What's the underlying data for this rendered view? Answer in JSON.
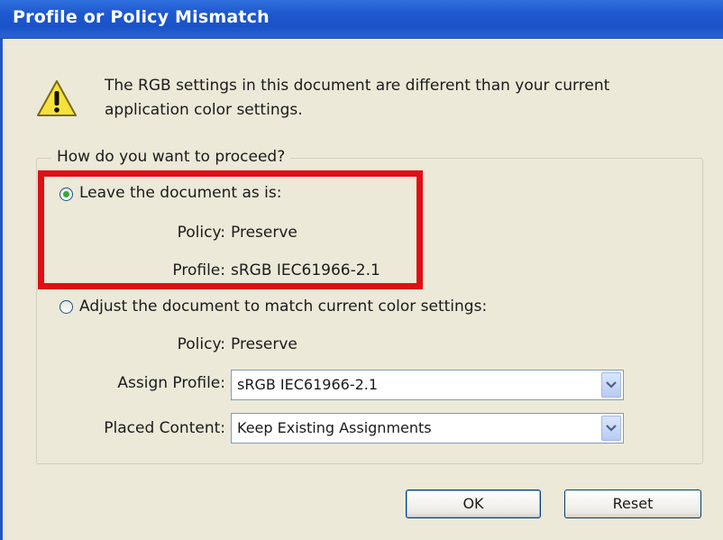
{
  "window": {
    "title": "Profile or Policy Mismatch"
  },
  "message": {
    "line1": "The RGB settings in this document are different than your current",
    "line2": "application color settings."
  },
  "group": {
    "legend": "How do you want to proceed?",
    "option_leave": {
      "label": "Leave the document as is:",
      "selected": true,
      "policy_label": "Policy:",
      "policy_value": "Preserve",
      "profile_label": "Profile:",
      "profile_value": "sRGB IEC61966-2.1"
    },
    "option_adjust": {
      "label": "Adjust the document to match current color settings:",
      "selected": false,
      "policy_label": "Policy:",
      "policy_value": "Preserve",
      "assign_profile_label": "Assign Profile:",
      "assign_profile_value": "sRGB IEC61966-2.1",
      "placed_content_label": "Placed Content:",
      "placed_content_value": "Keep Existing Assignments"
    }
  },
  "buttons": {
    "ok": "OK",
    "reset": "Reset"
  },
  "colors": {
    "highlight": "#e00f15",
    "titlebar": "#1f59cf",
    "face": "#ece9d8"
  },
  "icons": {
    "warning": "warning-icon",
    "dropdown": "chevron-down-icon"
  }
}
